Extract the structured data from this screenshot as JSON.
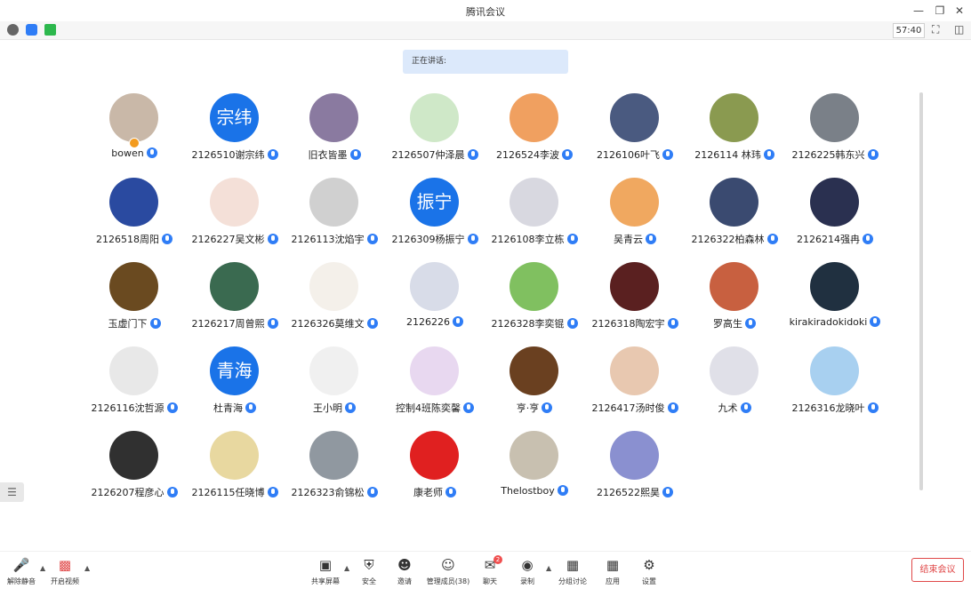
{
  "window": {
    "title": "腾讯会议"
  },
  "infobar": {
    "timer": "57:40"
  },
  "speaking": {
    "label": "正在讲话:"
  },
  "participants": [
    {
      "name": "bowen",
      "initials": "",
      "color": "#c9b8a8"
    },
    {
      "name": "2126510谢宗纬",
      "initials": "宗纬",
      "color": "#1a73e8"
    },
    {
      "name": "旧衣皆墨",
      "initials": "",
      "color": "#8a7aa0"
    },
    {
      "name": "2126507仲泽晨",
      "initials": "",
      "color": "#cfe8c8"
    },
    {
      "name": "2126524李波",
      "initials": "",
      "color": "#f0a060"
    },
    {
      "name": "2126106叶飞",
      "initials": "",
      "color": "#4a5a80"
    },
    {
      "name": "2126114 林玮",
      "initials": "",
      "color": "#8a9a50"
    },
    {
      "name": "2126225韩东兴",
      "initials": "",
      "color": "#7a8088"
    },
    {
      "name": "2126518周阳",
      "initials": "",
      "color": "#2a4aa0"
    },
    {
      "name": "2126227吴文彬",
      "initials": "",
      "color": "#f4e0d8"
    },
    {
      "name": "2126113沈焰宇",
      "initials": "",
      "color": "#d0d0d0"
    },
    {
      "name": "2126309杨振宁",
      "initials": "振宁",
      "color": "#1a73e8"
    },
    {
      "name": "2126108李立栋",
      "initials": "",
      "color": "#d8d8e0"
    },
    {
      "name": "吴青云",
      "initials": "",
      "color": "#f0a860"
    },
    {
      "name": "2126322柏森林",
      "initials": "",
      "color": "#3a4a70"
    },
    {
      "name": "2126214强冉",
      "initials": "",
      "color": "#2a3050"
    },
    {
      "name": "玉虚门下",
      "initials": "",
      "color": "#6a4a20"
    },
    {
      "name": "2126217周曾熙",
      "initials": "",
      "color": "#3a6a50"
    },
    {
      "name": "2126326莫维文",
      "initials": "",
      "color": "#f4f0ea"
    },
    {
      "name": "2126226",
      "initials": "",
      "color": "#d8dce8"
    },
    {
      "name": "2126328李奕锟",
      "initials": "",
      "color": "#80c060"
    },
    {
      "name": "2126318陶宏宇",
      "initials": "",
      "color": "#5a2020"
    },
    {
      "name": "罗高生",
      "initials": "",
      "color": "#c86040"
    },
    {
      "name": "kirakiradokidoki",
      "initials": "",
      "color": "#203040"
    },
    {
      "name": "2126116沈哲源",
      "initials": "",
      "color": "#e8e8e8"
    },
    {
      "name": "杜青海",
      "initials": "青海",
      "color": "#1a73e8"
    },
    {
      "name": "王小明",
      "initials": "",
      "color": "#f0f0f0"
    },
    {
      "name": "控制4班陈奕馨",
      "initials": "",
      "color": "#e8d8f0"
    },
    {
      "name": "亨·亨",
      "initials": "",
      "color": "#6a4020"
    },
    {
      "name": "2126417汤时俊",
      "initials": "",
      "color": "#e8c8b0"
    },
    {
      "name": "九术",
      "initials": "",
      "color": "#e0e0e8"
    },
    {
      "name": "2126316龙晓叶",
      "initials": "",
      "color": "#a8d0f0"
    },
    {
      "name": "2126207程彦心",
      "initials": "",
      "color": "#303030"
    },
    {
      "name": "2126115任晓博",
      "initials": "",
      "color": "#e8d8a0"
    },
    {
      "name": "2126323俞锦松",
      "initials": "",
      "color": "#9098a0"
    },
    {
      "name": "康老师",
      "initials": "",
      "color": "#e02020"
    },
    {
      "name": "Thelostboy",
      "initials": "",
      "color": "#c8c0b0"
    },
    {
      "name": "2126522熙昊",
      "initials": "",
      "color": "#8a90d0"
    }
  ],
  "toolbar": {
    "unmute": "解除静音",
    "video": "开启视频",
    "share": "共享屏幕",
    "security": "安全",
    "invite": "邀请",
    "members": "管理成员(38)",
    "chat": "聊天",
    "chat_badge": "2",
    "record": "录制",
    "breakout": "分组讨论",
    "apps": "应用",
    "settings": "设置",
    "end": "结束会议"
  }
}
